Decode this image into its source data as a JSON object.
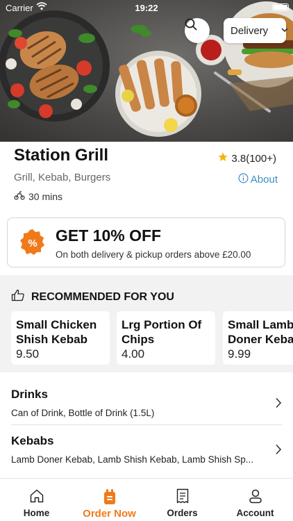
{
  "status_bar": {
    "carrier": "Carrier",
    "time": "19:22"
  },
  "header": {
    "delivery_mode": "Delivery",
    "search_icon": "search-icon"
  },
  "restaurant": {
    "name": "Station Grill",
    "rating": "3.8(100+)",
    "cuisines": "Grill, Kebab, Burgers",
    "about_label": "About",
    "delivery_time": "30 mins"
  },
  "offer": {
    "title": "GET 10% OFF",
    "subtitle": "On both delivery & pickup orders above £20.00",
    "accent": "#f07a1a"
  },
  "recommended": {
    "heading": "RECOMMENDED FOR YOU",
    "items": [
      {
        "name_line1": "Small Chicken",
        "name_line2": "Shish Kebab",
        "price": "9.50"
      },
      {
        "name_line1": "Lrg Portion Of",
        "name_line2": "Chips",
        "price": "4.00"
      },
      {
        "name_line1": "Small Lamb",
        "name_line2": "Doner Kebab",
        "price": "9.99"
      }
    ]
  },
  "categories": [
    {
      "title": "Drinks",
      "description": "Can of Drink, Bottle of Drink (1.5L)"
    },
    {
      "title": "Kebabs",
      "description": "Lamb Doner Kebab, Lamb Shish Kebab, Lamb Shish Sp..."
    }
  ],
  "tabs": [
    {
      "label": "Home",
      "icon": "home-icon"
    },
    {
      "label": "Order Now",
      "icon": "order-bag-icon"
    },
    {
      "label": "Orders",
      "icon": "receipt-icon"
    },
    {
      "label": "Account",
      "icon": "user-icon"
    }
  ],
  "colors": {
    "accent": "#f07a1a",
    "link": "#3c8fc1",
    "star": "#f5b400"
  }
}
